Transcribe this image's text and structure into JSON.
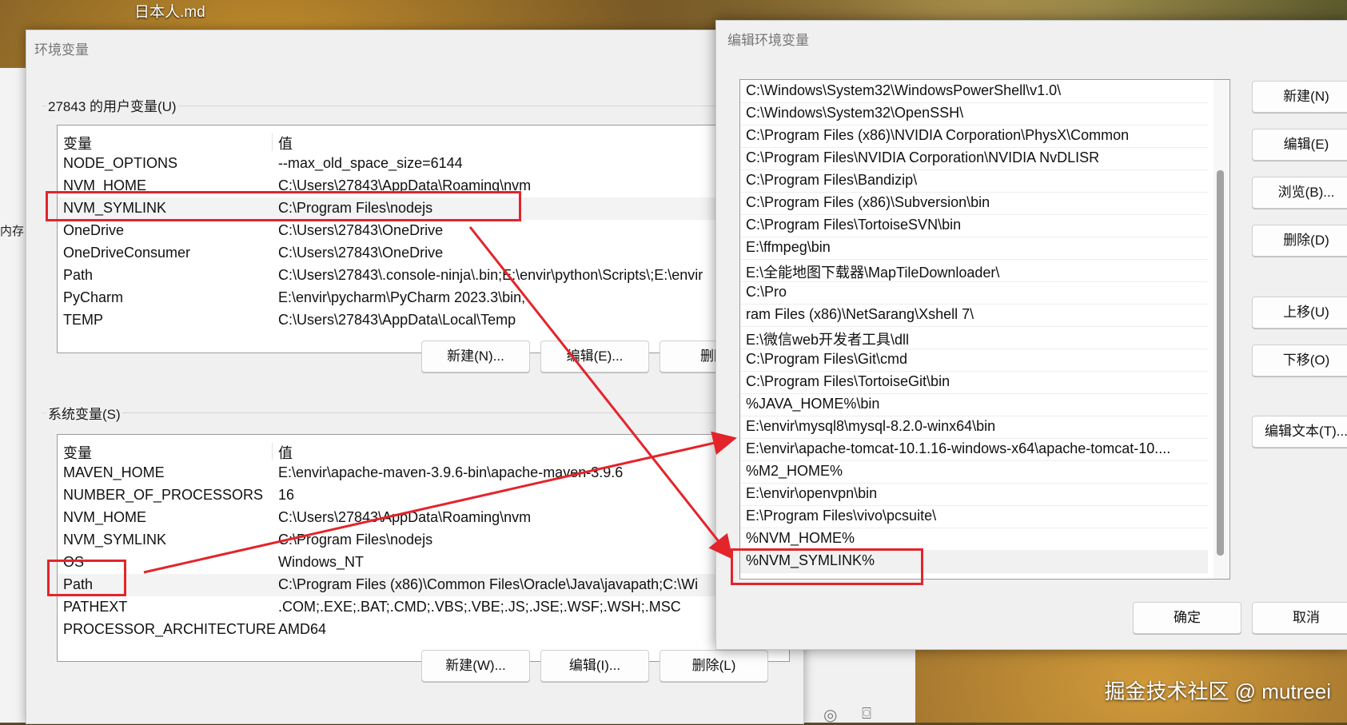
{
  "desktop": {
    "file_label": "日本人.md",
    "side_text": "内存"
  },
  "env_dialog": {
    "title": "环境变量",
    "user_group_title": "27843 的用户变量(U)",
    "system_group_title": "系统变量(S)",
    "columns": {
      "variable": "变量",
      "value": "值"
    },
    "user_rows": [
      {
        "name": "NODE_OPTIONS",
        "value": "--max_old_space_size=6144"
      },
      {
        "name": "NVM_HOME",
        "value": "C:\\Users\\27843\\AppData\\Roaming\\nvm"
      },
      {
        "name": "NVM_SYMLINK",
        "value": "C:\\Program Files\\nodejs"
      },
      {
        "name": "OneDrive",
        "value": "C:\\Users\\27843\\OneDrive"
      },
      {
        "name": "OneDriveConsumer",
        "value": "C:\\Users\\27843\\OneDrive"
      },
      {
        "name": "Path",
        "value": "C:\\Users\\27843\\.console-ninja\\.bin;E:\\envir\\python\\Scripts\\;E:\\envir"
      },
      {
        "name": "PyCharm",
        "value": "E:\\envir\\pycharm\\PyCharm 2023.3\\bin;"
      },
      {
        "name": "TEMP",
        "value": "C:\\Users\\27843\\AppData\\Local\\Temp"
      }
    ],
    "system_rows": [
      {
        "name": "MAVEN_HOME",
        "value": "E:\\envir\\apache-maven-3.9.6-bin\\apache-maven-3.9.6"
      },
      {
        "name": "NUMBER_OF_PROCESSORS",
        "value": "16"
      },
      {
        "name": "NVM_HOME",
        "value": "C:\\Users\\27843\\AppData\\Roaming\\nvm"
      },
      {
        "name": "NVM_SYMLINK",
        "value": "C:\\Program Files\\nodejs"
      },
      {
        "name": "OS",
        "value": "Windows_NT"
      },
      {
        "name": "Path",
        "value": "C:\\Program Files (x86)\\Common Files\\Oracle\\Java\\javapath;C:\\Wi"
      },
      {
        "name": "PATHEXT",
        "value": ".COM;.EXE;.BAT;.CMD;.VBS;.VBE;.JS;.JSE;.WSF;.WSH;.MSC"
      },
      {
        "name": "PROCESSOR_ARCHITECTURE",
        "value": "AMD64"
      }
    ],
    "user_buttons": {
      "new": "新建(N)...",
      "edit": "编辑(E)...",
      "delete": "删除"
    },
    "system_buttons": {
      "new": "新建(W)...",
      "edit": "编辑(I)...",
      "delete": "删除(L)"
    }
  },
  "edit_dialog": {
    "title": "编辑环境变量",
    "entries": [
      "C:\\Windows\\System32\\WindowsPowerShell\\v1.0\\",
      "C:\\Windows\\System32\\OpenSSH\\",
      "C:\\Program Files (x86)\\NVIDIA Corporation\\PhysX\\Common",
      "C:\\Program Files\\NVIDIA Corporation\\NVIDIA NvDLISR",
      "C:\\Program Files\\Bandizip\\",
      "C:\\Program Files (x86)\\Subversion\\bin",
      "C:\\Program Files\\TortoiseSVN\\bin",
      "E:\\ffmpeg\\bin",
      "E:\\全能地图下载器\\MapTileDownloader\\",
      "C:\\Pro",
      "ram Files (x86)\\NetSarang\\Xshell 7\\",
      "E:\\微信web开发者工具\\dll",
      "C:\\Program Files\\Git\\cmd",
      "C:\\Program Files\\TortoiseGit\\bin",
      "%JAVA_HOME%\\bin",
      "E:\\envir\\mysql8\\mysql-8.2.0-winx64\\bin",
      "E:\\envir\\apache-tomcat-10.1.16-windows-x64\\apache-tomcat-10....",
      "%M2_HOME%",
      "E:\\envir\\openvpn\\bin",
      "E:\\Program Files\\vivo\\pcsuite\\",
      "%NVM_HOME%",
      "%NVM_SYMLINK%"
    ],
    "buttons": {
      "new": "新建(N)",
      "edit": "编辑(E)",
      "browse": "浏览(B)...",
      "delete": "删除(D)",
      "move_up": "上移(U)",
      "move_down": "下移(O)",
      "edit_text": "编辑文本(T)...",
      "ok": "确定",
      "cancel": "取消"
    }
  },
  "watermark": "掘金技术社区 @ mutreei",
  "annotation_color": "#e3242b"
}
